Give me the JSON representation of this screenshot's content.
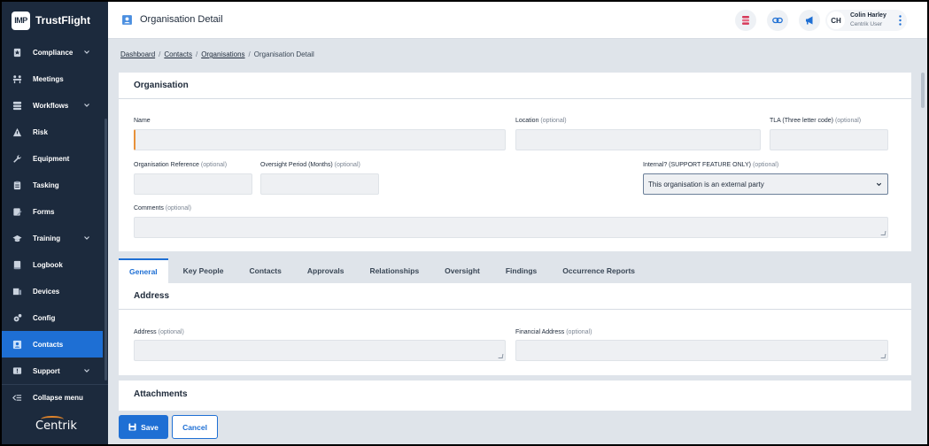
{
  "brand": {
    "logo_text": "IMP",
    "name": "TrustFlight"
  },
  "sidebar": {
    "items": [
      {
        "label": "Compliance",
        "icon": "compliance-icon",
        "has_caret": true
      },
      {
        "label": "Meetings",
        "icon": "meetings-icon",
        "has_caret": false
      },
      {
        "label": "Workflows",
        "icon": "workflows-icon",
        "has_caret": true
      },
      {
        "label": "Risk",
        "icon": "risk-icon",
        "has_caret": false
      },
      {
        "label": "Equipment",
        "icon": "wrench-icon",
        "has_caret": false
      },
      {
        "label": "Tasking",
        "icon": "tasking-icon",
        "has_caret": false
      },
      {
        "label": "Forms",
        "icon": "forms-icon",
        "has_caret": false
      },
      {
        "label": "Training",
        "icon": "graduation-cap-icon",
        "has_caret": true
      },
      {
        "label": "Logbook",
        "icon": "book-icon",
        "has_caret": false
      },
      {
        "label": "Devices",
        "icon": "devices-icon",
        "has_caret": false
      },
      {
        "label": "Config",
        "icon": "config-icon",
        "has_caret": false
      },
      {
        "label": "Contacts",
        "icon": "contacts-icon",
        "has_caret": false,
        "active": true
      },
      {
        "label": "Support",
        "icon": "support-icon",
        "has_caret": true
      }
    ],
    "collapse_label": "Collapse menu",
    "footer_logo": "Centrik"
  },
  "header": {
    "title": "Organisation Detail",
    "user": {
      "initials": "CH",
      "name": "Colin Harley",
      "role": "Centrik User"
    }
  },
  "breadcrumb": {
    "items": [
      "Dashboard",
      "Contacts",
      "Organisations"
    ],
    "current": "Organisation Detail"
  },
  "organisation": {
    "heading": "Organisation",
    "name_label": "Name",
    "location_label": "Location",
    "tla_label": "TLA (Three letter code)",
    "org_ref_label": "Organisation Reference",
    "oversight_label": "Oversight Period (Months)",
    "internal_label": "Internal? (SUPPORT FEATURE ONLY)",
    "internal_value": "This organisation is an external party",
    "comments_label": "Comments",
    "optional": "(optional)"
  },
  "tabs": [
    "General",
    "Key People",
    "Contacts",
    "Approvals",
    "Relationships",
    "Oversight",
    "Findings",
    "Occurrence Reports"
  ],
  "address": {
    "heading": "Address",
    "address_label": "Address",
    "financial_label": "Financial Address"
  },
  "attachments": {
    "heading": "Attachments"
  },
  "buttons": {
    "save": "Save",
    "cancel": "Cancel"
  },
  "colors": {
    "sidebar": "#1c2a3d",
    "accent": "#1e6fd4",
    "focus": "#e8913a"
  }
}
